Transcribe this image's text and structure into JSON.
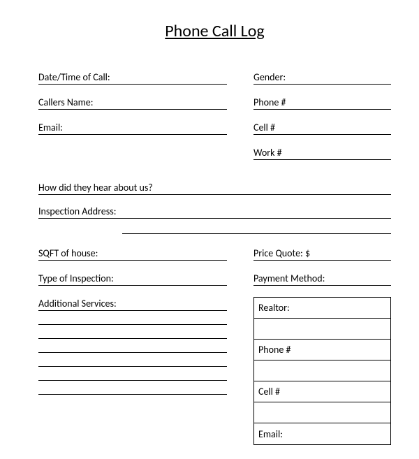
{
  "title": "Phone Call Log",
  "left": {
    "datetime": "Date/Time of Call:",
    "callers_name": "Callers Name:",
    "email": "Email:",
    "hear_about": "How did they hear about us?",
    "inspection_address": "Inspection Address:",
    "sqft": "SQFT of house:",
    "type_inspection": "Type of Inspection:",
    "additional_services": "Additional Services:"
  },
  "right": {
    "gender": "Gender:",
    "phone": "Phone #",
    "cell": "Cell #",
    "work": "Work #",
    "price_quote": "Price Quote: $",
    "payment_method": "Payment Method:"
  },
  "realtor_box": {
    "realtor": "Realtor:",
    "phone": "Phone #",
    "cell": "Cell #",
    "email": "Email:"
  }
}
